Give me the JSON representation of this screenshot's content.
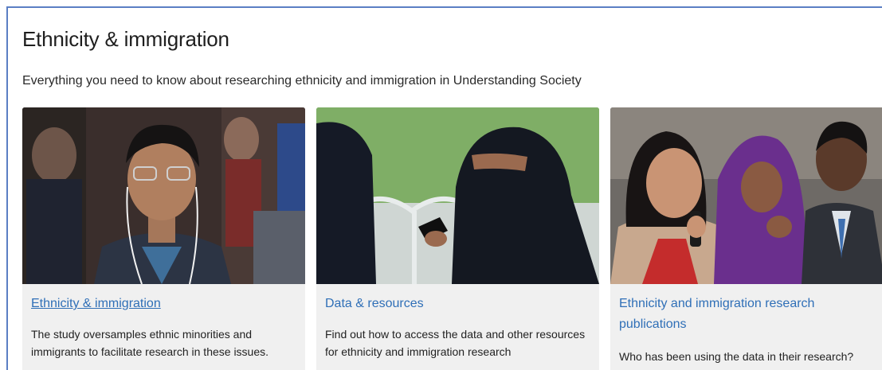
{
  "page": {
    "title": "Ethnicity & immigration",
    "intro": "Everything you need to know about researching ethnicity and immigration in Understanding Society"
  },
  "cards": [
    {
      "title": "Ethnicity & immigration",
      "text": "The study oversamples ethnic minorities and immigrants to facilitate research in these issues.",
      "image": "man-with-earphones-photo"
    },
    {
      "title": "Data & resources",
      "text": "Find out how to access the data and other resources for ethnicity and immigration research",
      "image": "woman-in-niqab-with-phone-photo"
    },
    {
      "title": "Ethnicity and immigration research publications",
      "text": "Who has been using the data in their research?",
      "image": "panel-speakers-photo"
    }
  ],
  "colors": {
    "link": "#2f6fb7",
    "card_bg": "#f0f0f0",
    "frame_border": "#5b7fc4"
  }
}
